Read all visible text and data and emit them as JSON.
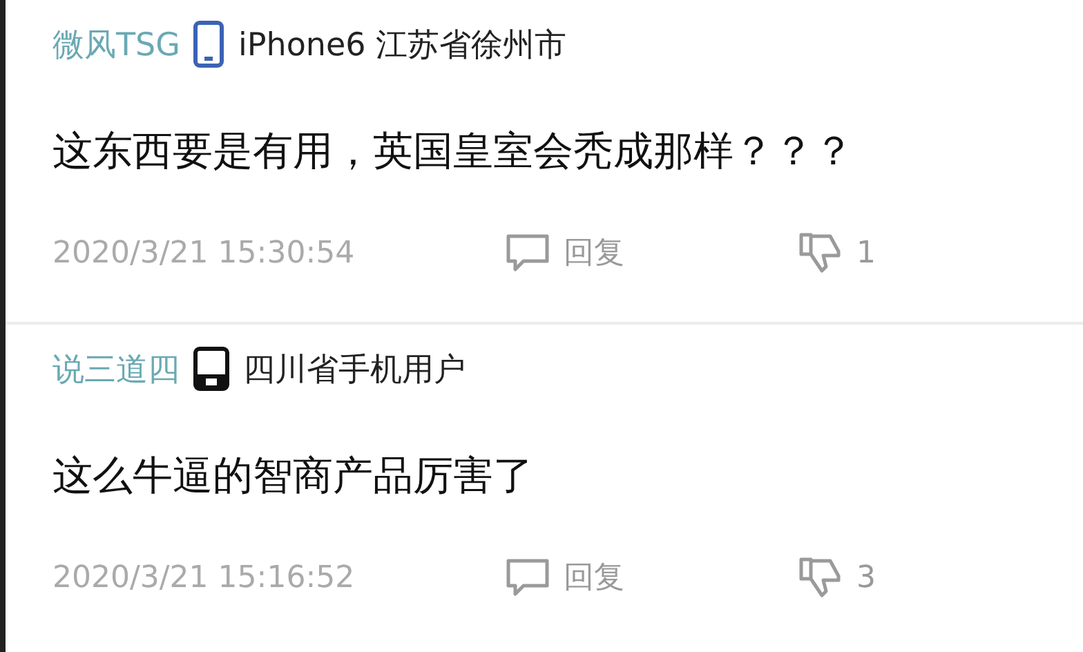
{
  "comments": [
    {
      "user": "微风TSG",
      "device": {
        "kind": "smartphone",
        "label": "iPhone6 江苏省徐州市"
      },
      "text": "这东西要是有用，英国皇室会秃成那样？？？",
      "time": "2020/3/21 15:30:54",
      "reply": "回复",
      "dislikes": "1"
    },
    {
      "user": "说三道四",
      "device": {
        "kind": "featurephone",
        "label": "四川省手机用户"
      },
      "text": "这么牛逼的智商产品厉害了",
      "time": "2020/3/21 15:16:52",
      "reply": "回复",
      "dislikes": "3"
    }
  ]
}
